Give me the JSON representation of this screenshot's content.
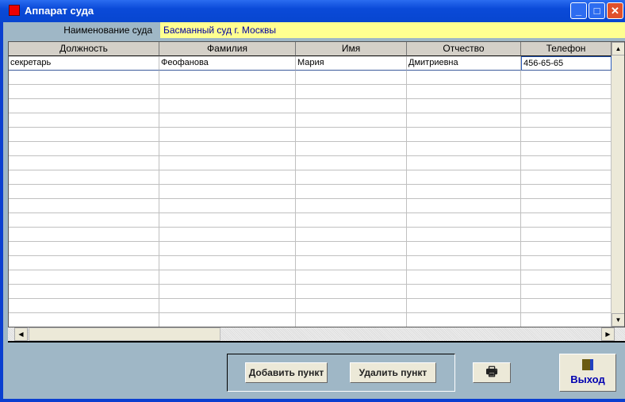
{
  "window": {
    "title": "Аппарат суда",
    "minimize": "_",
    "maximize": "□",
    "close": "✕"
  },
  "court": {
    "label": "Наименование суда",
    "value": "Басманный суд г. Москвы"
  },
  "table": {
    "columns": [
      "Должность",
      "Фамилия",
      "Имя",
      "Отчество",
      "Телефон"
    ],
    "rows": [
      [
        "секретарь",
        "Феофанова",
        "Мария",
        "Дмитриевна",
        "456-65-65"
      ]
    ],
    "empty_rows": 18
  },
  "buttons": {
    "add": "Добавить пункт",
    "delete": "Удалить пункт",
    "print_icon": "🖶",
    "exit": "Выход",
    "exit_icon": "door-exit-icon"
  }
}
